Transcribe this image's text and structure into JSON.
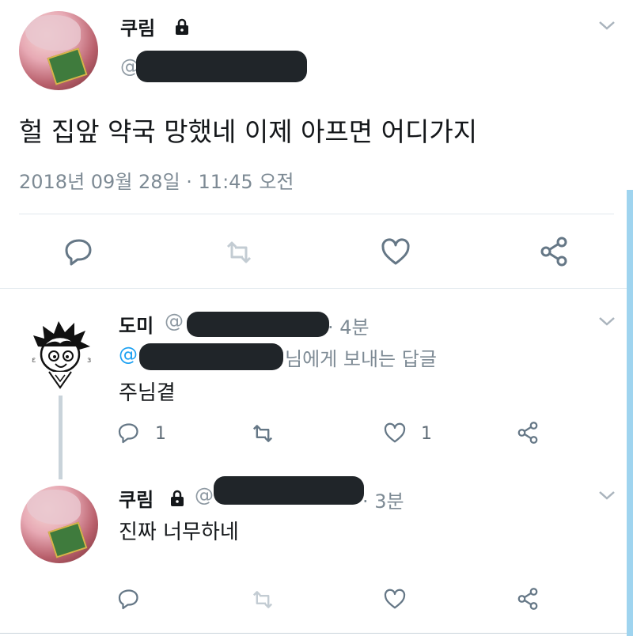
{
  "main_tweet": {
    "display_name": "쿠림",
    "handle_prefix": "@",
    "text": "헐 집앞 약국 망했네 이제 아프면 어디가지",
    "timestamp": "2018년 09월 28일 · 11:45 오전"
  },
  "reply1": {
    "display_name": "도미",
    "handle_prefix": "@",
    "time": "· 4분",
    "reply_to_prefix": "@",
    "reply_to_suffix": "님에게 보내는 답글",
    "text": "주님곁",
    "reply_count": "1",
    "like_count": "1"
  },
  "reply2": {
    "display_name": "쿠림",
    "handle_prefix": "@",
    "time": "· 3분",
    "text": "진짜 너무하네"
  },
  "colors": {
    "accent": "#1da1f2",
    "icon_gray": "#657786",
    "icon_light": "#aab8c2",
    "redaction": "#202529"
  }
}
